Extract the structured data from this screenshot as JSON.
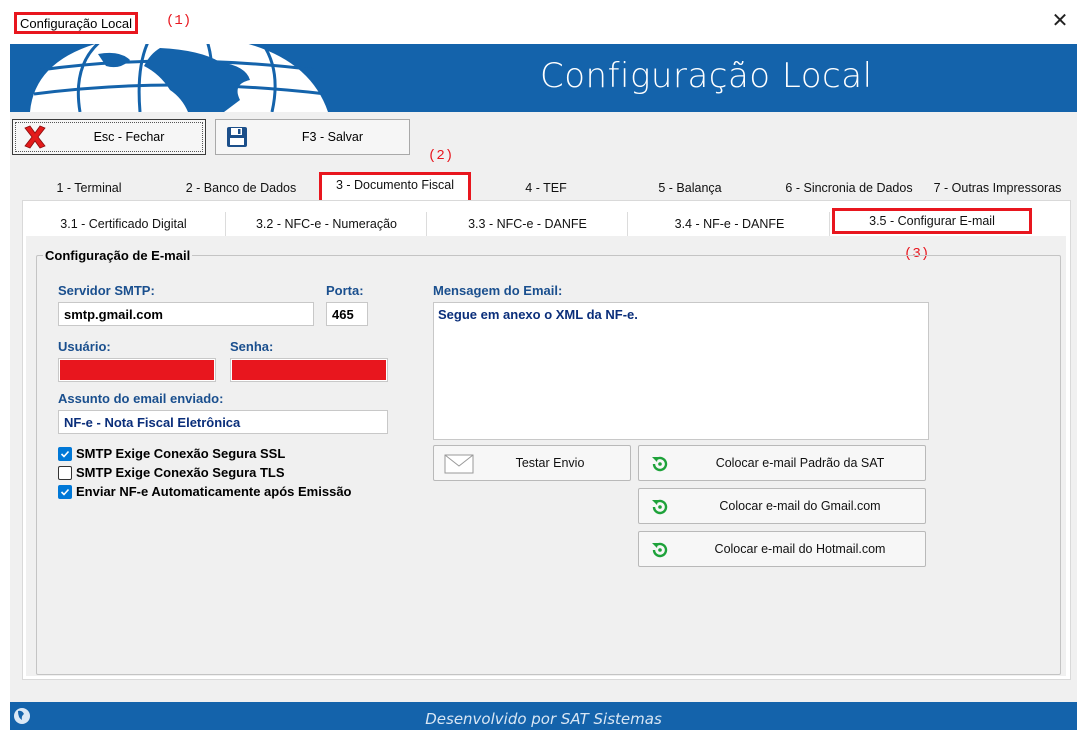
{
  "window": {
    "title": "Configuração Local",
    "annotation": "(1)",
    "close_label": "✕"
  },
  "banner": {
    "title": "Configuração Local"
  },
  "toolbar": {
    "close_label": "Esc - Fechar",
    "save_label": "F3 - Salvar"
  },
  "annotations": {
    "tab_main": "(2)",
    "tab_sub": "(3)"
  },
  "tabs_main": [
    {
      "label": "1 - Terminal"
    },
    {
      "label": "2 - Banco de Dados"
    },
    {
      "label": "3 - Documento Fiscal"
    },
    {
      "label": "4 - TEF"
    },
    {
      "label": "5 - Balança"
    },
    {
      "label": "6 - Sincronia de Dados"
    },
    {
      "label": "7 - Outras Impressoras"
    }
  ],
  "tabs_sub": [
    {
      "label": "3.1 - Certificado Digital"
    },
    {
      "label": "3.2 - NFC-e - Numeração"
    },
    {
      "label": "3.3 - NFC-e - DANFE"
    },
    {
      "label": "3.4 - NF-e - DANFE"
    },
    {
      "label": "3.5 - Configurar E-mail"
    }
  ],
  "email_config": {
    "group_title": "Configuração de E-mail",
    "smtp_label": "Servidor SMTP:",
    "smtp_value": "smtp.gmail.com",
    "port_label": "Porta:",
    "port_value": "465",
    "user_label": "Usuário:",
    "password_label": "Senha:",
    "subject_label": "Assunto do email enviado:",
    "subject_value": "NF-e - Nota Fiscal Eletrônica",
    "message_label": "Mensagem do Email:",
    "message_value": "Segue em anexo o XML da NF-e.",
    "ssl_label": "SMTP Exige Conexão Segura SSL",
    "tls_label": "SMTP Exige Conexão Segura TLS",
    "auto_send_label": "Enviar NF-e Automaticamente após Emissão",
    "test_button": "Testar Envio",
    "preset_sat": "Colocar e-mail Padrão da SAT",
    "preset_gmail": "Colocar e-mail do Gmail.com",
    "preset_hotmail": "Colocar e-mail do Hotmail.com"
  },
  "footer": {
    "text": "Desenvolvido por SAT Sistemas"
  },
  "colors": {
    "brand": "#1463ab",
    "highlight": "#e8161e",
    "label": "#1a4f8e"
  }
}
